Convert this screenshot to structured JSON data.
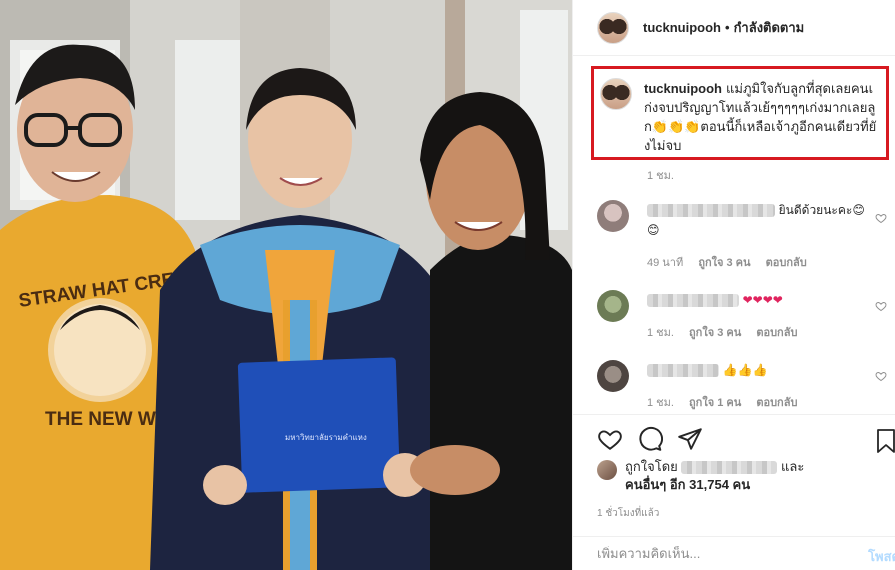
{
  "post": {
    "username": "tucknuipooh",
    "dot": "•",
    "follow_status": "กำลังติดตาม"
  },
  "caption": {
    "username": "tucknuipooh",
    "text": "แม่ภูมิใจกับลูกที่สุดเลยคนเก่งจบปริญญาโทแล้วเย้ๆๆๆๆๆเก่งมากเลยลูก👏👏👏ตอนนี้ก็เหลือเจ้าภูอีกคนเดียวที่ยังไม่จบ",
    "time": "1 ชม."
  },
  "comments": [
    {
      "text": "ยินดีด้วยนะคะ😊😊",
      "time": "49 นาที",
      "likes": "ถูกใจ 3 คน",
      "reply": "ตอบกลับ"
    },
    {
      "text": "❤❤❤❤",
      "time": "1 ชม.",
      "likes": "ถูกใจ 3 คน",
      "reply": "ตอบกลับ"
    },
    {
      "text": "👍👍👍",
      "time": "1 ชม.",
      "likes": "ถูกใจ 1 คน",
      "reply": "ตอบกลับ"
    }
  ],
  "likes": {
    "prefix": "ถูกใจโดย",
    "and": "และ",
    "others": "คนอื่นๆ อีก 31,754 คน"
  },
  "posted_ago": "1 ชั่วโมงที่แล้ว",
  "add_comment": {
    "placeholder": "เพิ่มความคิดเห็น...",
    "post_label": "โพสต์"
  },
  "icons": [
    "heart-icon",
    "comment-icon",
    "share-icon",
    "bookmark-icon"
  ],
  "colors": {
    "highlight": "#d71920",
    "post_button": "#b3dbff",
    "muted": "#8e8e8e"
  }
}
